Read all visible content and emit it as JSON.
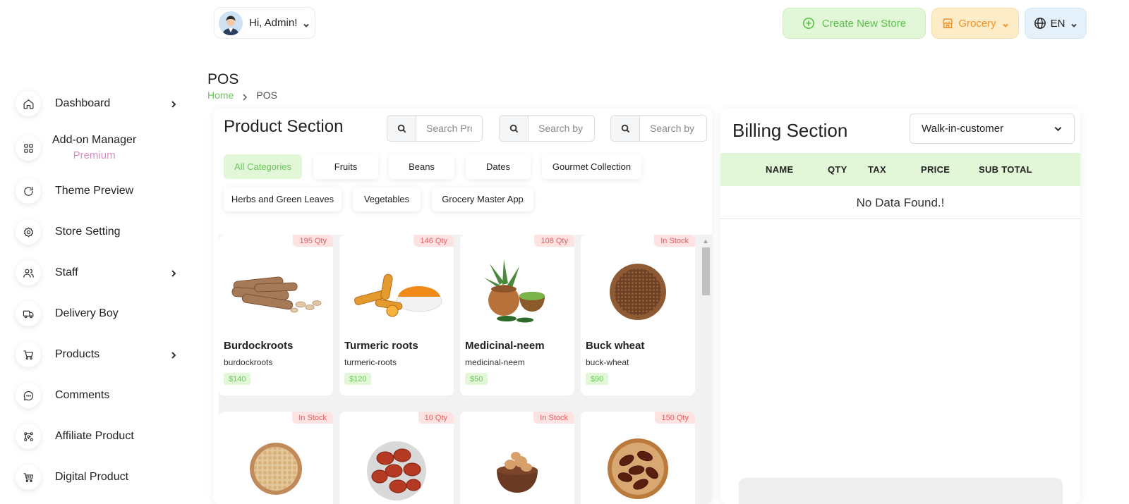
{
  "sidebar": {
    "items": [
      {
        "label": "Dashboard",
        "icon": "home-icon"
      },
      {
        "label": "Add-on Manager",
        "sub": "Premium",
        "icon": "grid-icon"
      },
      {
        "label": "Theme Preview",
        "icon": "refresh-icon"
      },
      {
        "label": "Store Setting",
        "icon": "gear-icon"
      },
      {
        "label": "Staff",
        "icon": "users-icon"
      },
      {
        "label": "Delivery Boy",
        "icon": "truck-icon"
      },
      {
        "label": "Products",
        "icon": "cart-icon"
      },
      {
        "label": "Comments",
        "icon": "comment-icon"
      },
      {
        "label": "Affiliate Product",
        "icon": "affiliate-icon"
      },
      {
        "label": "Digital Product",
        "icon": "digital-cart-icon"
      }
    ]
  },
  "header": {
    "greeting": "Hi, Admin!",
    "create_store": "Create New Store",
    "store_type": "Grocery",
    "language": "EN"
  },
  "page": {
    "title": "POS",
    "breadcrumb_home": "Home",
    "breadcrumb_current": "POS"
  },
  "product_section": {
    "title": "Product Section",
    "search_placeholders": [
      "Search Product",
      "Search by",
      "Search by"
    ],
    "categories": [
      "All Categories",
      "Fruits",
      "Beans",
      "Dates",
      "Gourmet Collection",
      "Herbs and Green Leaves",
      "Vegetables",
      "Grocery Master App"
    ],
    "active_category": "All Categories",
    "products": [
      {
        "name": "Burdockroots",
        "slug": "burdockroots",
        "price": "$140",
        "stock": "195 Qty"
      },
      {
        "name": "Turmeric roots",
        "slug": "turmeric-roots",
        "price": "$120",
        "stock": "146 Qty"
      },
      {
        "name": "Medicinal-neem",
        "slug": "medicinal-neem",
        "price": "$50",
        "stock": "108 Qty"
      },
      {
        "name": "Buck wheat",
        "slug": "buck-wheat",
        "price": "$90",
        "stock": "In Stock"
      },
      {
        "name": "",
        "slug": "",
        "price": "",
        "stock": "In Stock"
      },
      {
        "name": "",
        "slug": "",
        "price": "",
        "stock": "10 Qty"
      },
      {
        "name": "",
        "slug": "",
        "price": "",
        "stock": "In Stock"
      },
      {
        "name": "",
        "slug": "",
        "price": "",
        "stock": "150 Qty"
      }
    ]
  },
  "billing_section": {
    "title": "Billing Section",
    "customer": "Walk-in-customer",
    "columns": [
      "NAME",
      "QTY",
      "TAX",
      "PRICE",
      "SUB TOTAL"
    ],
    "empty_message": "No Data Found.!"
  },
  "colors": {
    "accent_green": "#6cc55b",
    "green_bg": "#e2f7d8",
    "orange": "#f0932b",
    "badge_red": "#e35d5d"
  }
}
